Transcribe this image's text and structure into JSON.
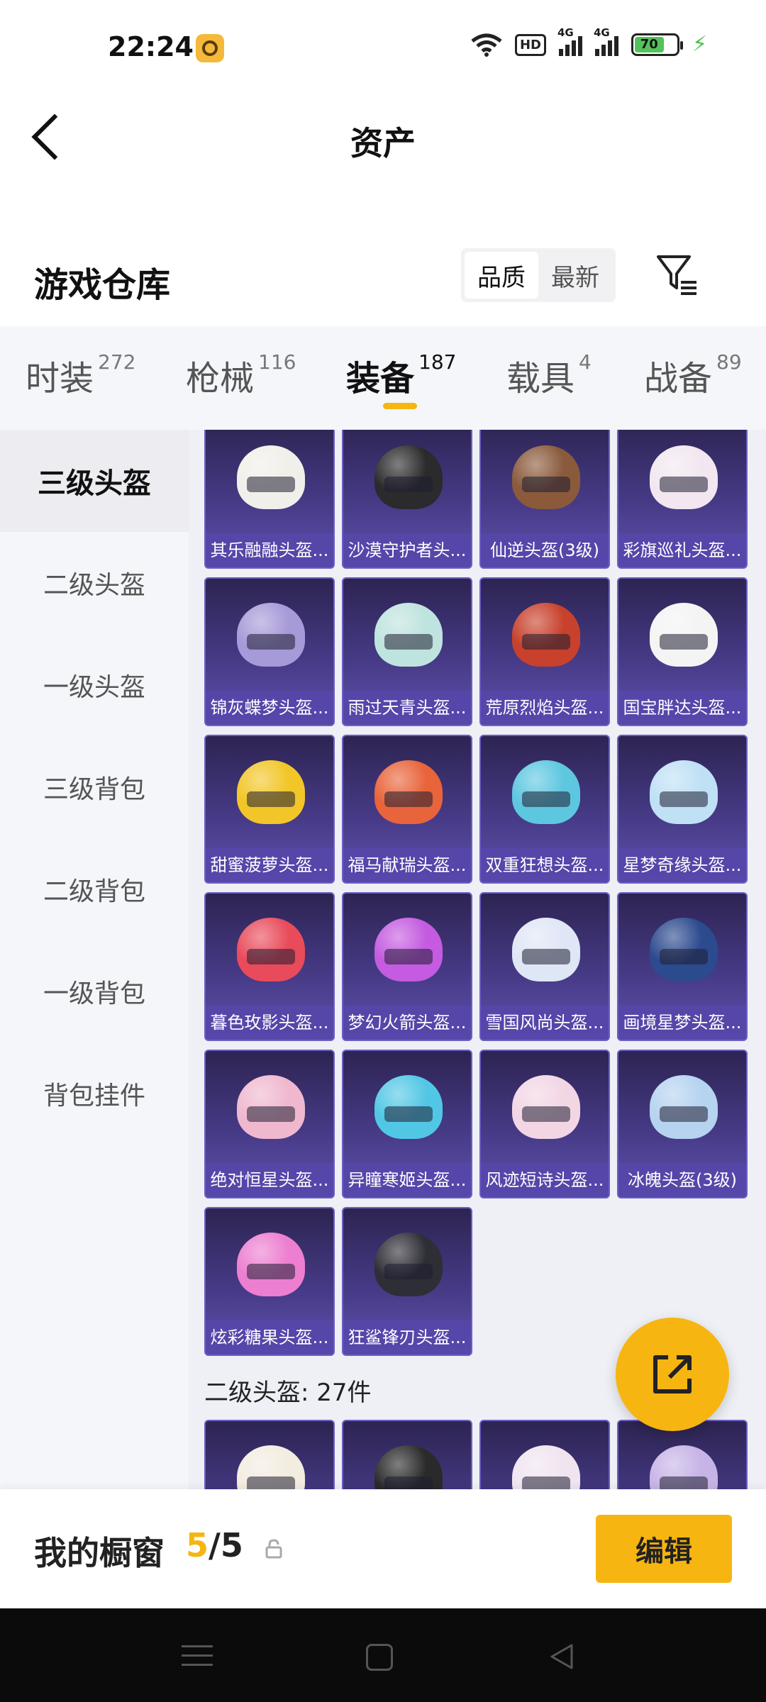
{
  "status_bar": {
    "time": "22:24",
    "hd_label": "HD",
    "signal_label": "4G",
    "battery": "70"
  },
  "nav": {
    "title": "资产"
  },
  "warehouse": {
    "title": "游戏仓库",
    "sort_options": [
      "品质",
      "最新"
    ],
    "active_sort": "品质"
  },
  "tabs": [
    {
      "label": "时装",
      "count": "272"
    },
    {
      "label": "枪械",
      "count": "116"
    },
    {
      "label": "装备",
      "count": "187",
      "active": true
    },
    {
      "label": "载具",
      "count": "4"
    },
    {
      "label": "战备",
      "count": "89"
    }
  ],
  "sidebar": {
    "items": [
      "三级头盔",
      "二级头盔",
      "一级头盔",
      "三级背包",
      "二级背包",
      "一级背包",
      "背包挂件"
    ],
    "active": "三级头盔"
  },
  "items": [
    {
      "name": "其乐融融头盔...",
      "color": "#f1efe9"
    },
    {
      "name": "沙漠守护者头...",
      "color": "#2b2a2c"
    },
    {
      "name": "仙逆头盔(3级)",
      "color": "#8a5a3b"
    },
    {
      "name": "彩旗巡礼头盔...",
      "color": "#f2e7f0"
    },
    {
      "name": "锦灰蝶梦头盔...",
      "color": "#a79ad8"
    },
    {
      "name": "雨过天青头盔...",
      "color": "#bfe3de"
    },
    {
      "name": "荒原烈焰头盔...",
      "color": "#c8412c"
    },
    {
      "name": "国宝胖达头盔...",
      "color": "#f4f4f4"
    },
    {
      "name": "甜蜜菠萝头盔...",
      "color": "#f2c628"
    },
    {
      "name": "福马献瑞头盔...",
      "color": "#e8643a"
    },
    {
      "name": "双重狂想头盔...",
      "color": "#5ec7e0"
    },
    {
      "name": "星梦奇缘头盔...",
      "color": "#bfe0f5"
    },
    {
      "name": "暮色玫影头盔...",
      "color": "#e94b5b"
    },
    {
      "name": "梦幻火箭头盔...",
      "color": "#c45be0"
    },
    {
      "name": "雪国风尚头盔...",
      "color": "#dfe6f5"
    },
    {
      "name": "画境星梦头盔...",
      "color": "#2c4a8e"
    },
    {
      "name": "绝对恒星头盔...",
      "color": "#f0b8cf"
    },
    {
      "name": "异瞳寒姬头盔...",
      "color": "#52c7e5"
    },
    {
      "name": "风迹短诗头盔...",
      "color": "#f2d6e4"
    },
    {
      "name": "冰魄头盔(3级)",
      "color": "#b6d3f0"
    },
    {
      "name": "炫彩糖果头盔...",
      "color": "#ec7fd0"
    },
    {
      "name": "狂鲨锋刃头盔...",
      "color": "#2e2e36"
    }
  ],
  "next_section": {
    "title": "二级头盔: 27件",
    "preview_colors": [
      "#f3ece0",
      "#2a2a2a",
      "#f0e4f0",
      "#c7b4e6"
    ]
  },
  "showcase": {
    "label": "我的橱窗",
    "current": "5",
    "separator": "/",
    "total": "5",
    "edit_label": "编辑"
  },
  "accent_color": "#f6b511"
}
